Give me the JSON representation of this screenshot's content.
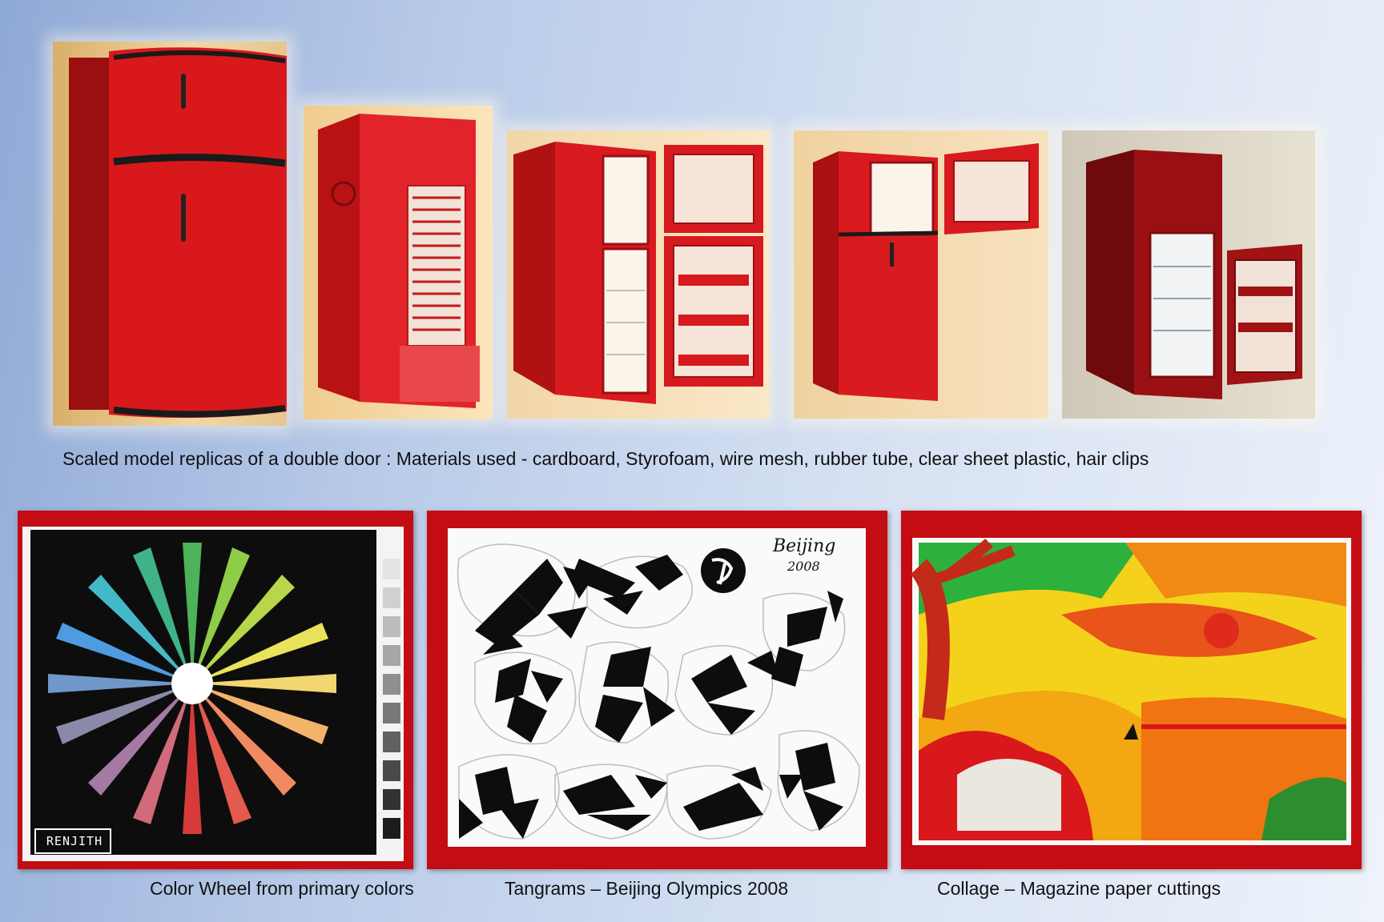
{
  "top_caption": "Scaled model replicas of a double door : Materials used - cardboard, Styrofoam, wire mesh, rubber tube, clear sheet plastic, hair clips",
  "bottom_captions": {
    "color_wheel": "Color Wheel from primary colors",
    "tangrams": "Tangrams – Beijing Olympics 2008",
    "collage": "Collage – Magazine paper cuttings"
  },
  "artwork_text": {
    "signature": "RENJITH",
    "beijing": "Beijing",
    "year": "2008"
  },
  "colors": {
    "fridge_red": "#d8181b",
    "frame_red": "#c40c12",
    "poster_black": "#0d0d0d"
  }
}
